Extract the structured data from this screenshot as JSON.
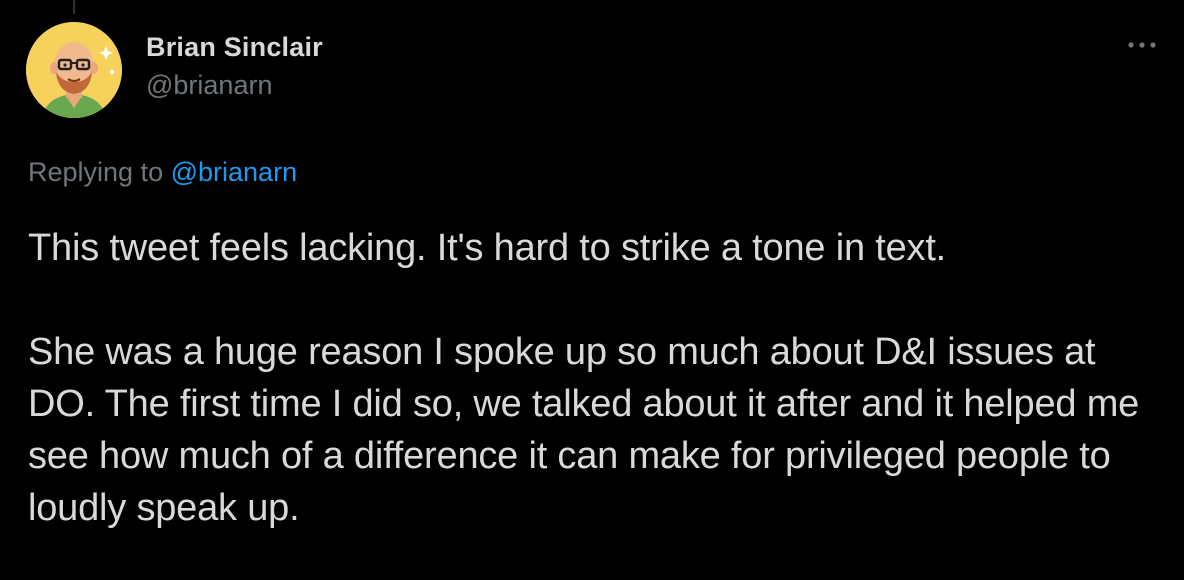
{
  "tweet": {
    "author": {
      "display_name": "Brian Sinclair",
      "handle": "@brianarn",
      "avatar_icon": "cartoon-avatar-bald-man-glasses-beard"
    },
    "more_icon": "more-horizontal-icon",
    "reply": {
      "prefix": "Replying to",
      "handle": "@brianarn"
    },
    "paragraphs": [
      "This tweet feels lacking. It's hard to strike a tone in text.",
      "She was a huge reason I spoke up so much about D&I issues at DO. The first time I did so, we talked about it after and it helped me see how much of a difference it can make for privileged people to loudly speak up."
    ]
  },
  "colors": {
    "background": "#000000",
    "text": "#d9d9d9",
    "secondary": "#71767b",
    "link": "#1d9bf0",
    "avatar_bg": "#f6d25c"
  }
}
